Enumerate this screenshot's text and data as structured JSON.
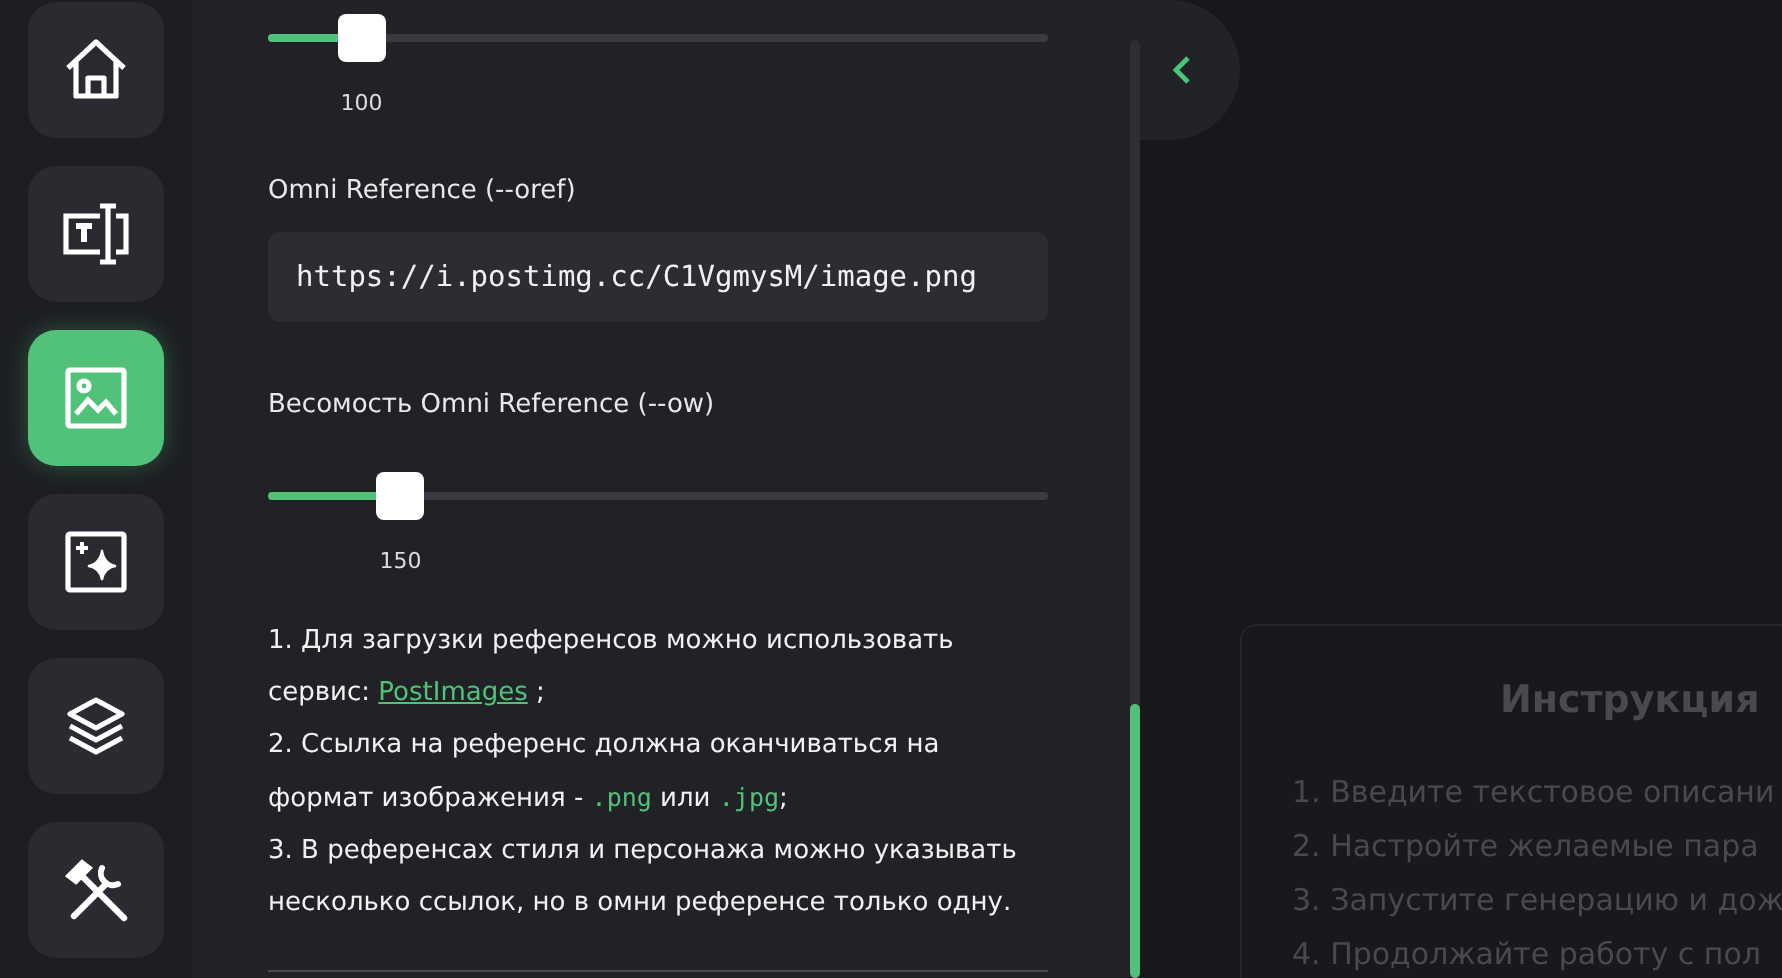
{
  "nav": [
    {
      "selected": false
    },
    {
      "selected": false
    },
    {
      "selected": true
    },
    {
      "selected": false
    },
    {
      "selected": false
    },
    {
      "selected": false
    }
  ],
  "sliders_top": {
    "level": 0.12,
    "value": "100"
  },
  "omni_reference": {
    "label": "Omni Reference (--oref)",
    "value": "https://i.postimg.cc/C1VgmysM/image.png"
  },
  "omni_weight": {
    "label": "Весомость Omni Reference (--ow)",
    "level": 0.17,
    "value": "150"
  },
  "notes": [
    {
      "parts": [
        {
          "kind": "text",
          "text": "1. Для загрузки референсов можно использовать сервис: "
        },
        {
          "kind": "link",
          "text": "PostImages"
        },
        {
          "kind": "text",
          "text": " ;"
        }
      ]
    },
    {
      "parts": [
        {
          "kind": "text",
          "text": "2. Ссылка на референс должна оканчиваться на формат изображения - "
        },
        {
          "kind": "code",
          "text": ".png"
        },
        {
          "kind": "text",
          "text": " или "
        },
        {
          "kind": "code",
          "text": ".jpg"
        },
        {
          "kind": "text",
          "text": ";"
        }
      ]
    },
    {
      "parts": [
        {
          "kind": "text",
          "text": "3. В референсах стиля и персонажа можно указывать несколько ссылок, но в омни референсе только одну."
        }
      ]
    }
  ],
  "instruction": {
    "title": "Инструкция",
    "steps": [
      "1. Введите текстовое описани",
      "2. Настройте желаемые пара",
      "3. Запустите генерацию и дож",
      "4. Продолжайте работу с пол"
    ]
  }
}
